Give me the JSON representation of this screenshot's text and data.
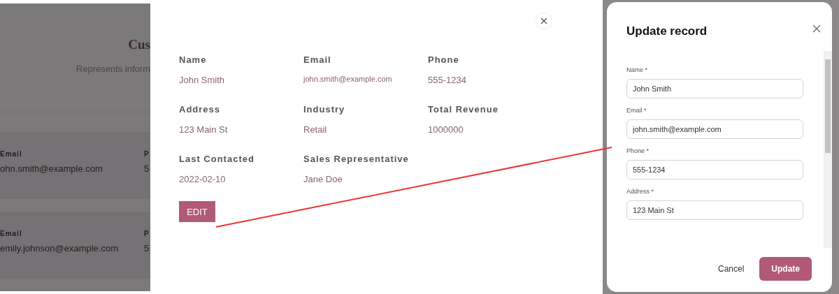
{
  "background_page": {
    "title": "Cus",
    "subtitle": "Represents inform",
    "rows": [
      {
        "label": "Email",
        "value": "ohn.smith@example.com",
        "column_2_label": "P",
        "column_2_value": "5"
      },
      {
        "label": "Email",
        "value": "emily.johnson@example.com",
        "column_2_label": "P",
        "column_2_value": "5"
      }
    ]
  },
  "details": {
    "fields": [
      {
        "label": "Name",
        "value": "John Smith"
      },
      {
        "label": "Email",
        "value": "john.smith@example.com"
      },
      {
        "label": "Phone",
        "value": "555-1234"
      },
      {
        "label": "Address",
        "value": "123 Main St"
      },
      {
        "label": "Industry",
        "value": "Retail"
      },
      {
        "label": "Total Revenue",
        "value": "1000000"
      },
      {
        "label": "Last Contacted",
        "value": "2022-02-10"
      },
      {
        "label": "Sales Representative",
        "value": "Jane Doe"
      }
    ],
    "edit_button": "EDIT"
  },
  "update_dialog": {
    "title": "Update record",
    "fields": [
      {
        "label": "Name *",
        "value": "John Smith"
      },
      {
        "label": "Email *",
        "value": "john.smith@example.com"
      },
      {
        "label": "Phone *",
        "value": "555-1234"
      },
      {
        "label": "Address *",
        "value": "123 Main St"
      }
    ],
    "buttons": [
      {
        "label": "Cancel",
        "kind": "text"
      },
      {
        "label": "Update",
        "kind": "primary"
      }
    ]
  }
}
